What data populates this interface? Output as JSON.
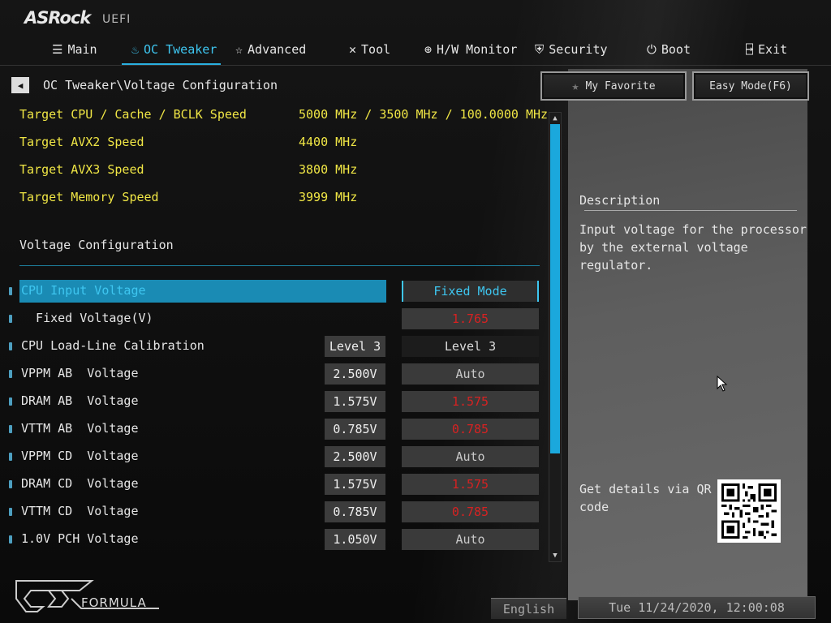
{
  "brand": {
    "name": "ASRock",
    "sub": "UEFI"
  },
  "nav": [
    {
      "label": "Main",
      "icon": "list-icon",
      "active": false
    },
    {
      "label": "OC Tweaker",
      "icon": "flame-icon",
      "active": true
    },
    {
      "label": "Advanced",
      "icon": "star-icon",
      "active": false
    },
    {
      "label": "Tool",
      "icon": "tools-icon",
      "active": false
    },
    {
      "label": "H/W Monitor",
      "icon": "monitor-icon",
      "active": false
    },
    {
      "label": "Security",
      "icon": "shield-icon",
      "active": false
    },
    {
      "label": "Boot",
      "icon": "power-icon",
      "active": false
    },
    {
      "label": "Exit",
      "icon": "exit-icon",
      "active": false
    }
  ],
  "breadcrumb": "OC Tweaker\\Voltage Configuration",
  "favorite_label": "My Favorite",
  "easy_mode_label": "Easy Mode(F6)",
  "targets": [
    {
      "label": "Target CPU / Cache / BCLK Speed",
      "value": "5000 MHz / 3500 MHz / 100.0000 MHz"
    },
    {
      "label": "Target AVX2 Speed",
      "value": "4400 MHz"
    },
    {
      "label": "Target AVX3 Speed",
      "value": "3800 MHz"
    },
    {
      "label": "Target Memory Speed",
      "value": "3999 MHz"
    }
  ],
  "section_title": "Voltage Configuration",
  "rows": [
    {
      "label": "CPU Input Voltage",
      "current": "",
      "setting": "Fixed Mode"
    },
    {
      "label": "  Fixed Voltage(V)",
      "current": "",
      "setting": "1.765"
    },
    {
      "label": "CPU Load-Line Calibration",
      "current": "Level 3",
      "setting": "Level 3"
    },
    {
      "label": "VPPM AB  Voltage",
      "current": "2.500V",
      "setting": "Auto"
    },
    {
      "label": "DRAM AB  Voltage",
      "current": "1.575V",
      "setting": "1.575"
    },
    {
      "label": "VTTM AB  Voltage",
      "current": "0.785V",
      "setting": "0.785"
    },
    {
      "label": "VPPM CD  Voltage",
      "current": "2.500V",
      "setting": "Auto"
    },
    {
      "label": "DRAM CD  Voltage",
      "current": "1.575V",
      "setting": "1.575"
    },
    {
      "label": "VTTM CD  Voltage",
      "current": "0.785V",
      "setting": "0.785"
    },
    {
      "label": "1.0V PCH Voltage",
      "current": "1.050V",
      "setting": "Auto"
    }
  ],
  "description": {
    "title": "Description",
    "text": "Input voltage for the processor by the external voltage regulator."
  },
  "qr_text": "Get details via QR code",
  "logo_text": "FORMULA",
  "language": "English",
  "datetime": "Tue 11/24/2020, 12:00:08",
  "colors": {
    "accent": "#1a8bb4",
    "target_text": "#f0e645",
    "modified_value": "#d62222"
  }
}
